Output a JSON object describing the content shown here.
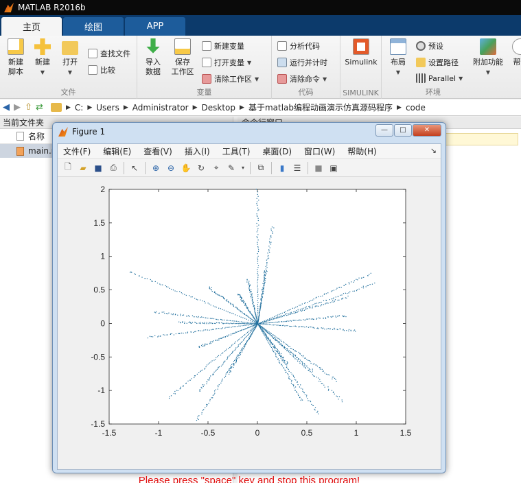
{
  "app": {
    "title": "MATLAB R2016b"
  },
  "tabs": [
    {
      "label": "主页"
    },
    {
      "label": "绘图"
    },
    {
      "label": "APP"
    }
  ],
  "ribbon": {
    "file": {
      "group_label": "文件",
      "new_script": "新建\n脚本",
      "new": "新建",
      "open": "打开",
      "find_files": "查找文件",
      "compare": "比较"
    },
    "variable": {
      "group_label": "变量",
      "import": "导入\n数据",
      "save_ws": "保存\n工作区",
      "new_var": "新建变量",
      "open_var": "打开变量",
      "clear_ws": "清除工作区"
    },
    "code": {
      "group_label": "代码",
      "analyze": "分析代码",
      "run_time": "运行并计时",
      "clear_cmd": "清除命令"
    },
    "simulink": {
      "group_label": "SIMULINK",
      "label": "Simulink"
    },
    "env": {
      "group_label": "环境",
      "layout": "布局",
      "prefs": "预设",
      "set_path": "设置路径",
      "parallel": "Parallel",
      "addons": "附加功能",
      "help_partial": "帮"
    }
  },
  "address": {
    "crumbs": [
      "C:",
      "Users",
      "Administrator",
      "Desktop",
      "基于matlab编程动画演示仿真源码程序",
      "code"
    ]
  },
  "left_panel": {
    "title": "当前文件夹",
    "col_name": "名称",
    "file": "main.r"
  },
  "right_panel": {
    "title": "命令行窗口"
  },
  "figure": {
    "title": "Figure 1",
    "menu": [
      "文件(F)",
      "编辑(E)",
      "查看(V)",
      "插入(I)",
      "工具(T)",
      "桌面(D)",
      "窗口(W)",
      "帮助(H)"
    ],
    "message": "Please press \"space\" key and stop this program!"
  },
  "chart_data": {
    "type": "scatter",
    "xlim": [
      -1.5,
      1.5
    ],
    "ylim": [
      -1.5,
      2
    ],
    "xticks": [
      "-1.5",
      "-1",
      "-0.5",
      "0",
      "0.5",
      "1",
      "1.5"
    ],
    "yticks": [
      "-1.5",
      "-1",
      "-0.5",
      "0",
      "0.5",
      "1",
      "1.5",
      "2"
    ],
    "marker_color": "#1f6e9c",
    "grid": false,
    "rays": [
      [
        0.0,
        2.0
      ],
      [
        0.15,
        1.45
      ],
      [
        -1.3,
        0.78
      ],
      [
        -0.5,
        0.55
      ],
      [
        -0.2,
        0.45
      ],
      [
        -0.1,
        0.65
      ],
      [
        0.08,
        0.8
      ],
      [
        1.15,
        0.75
      ],
      [
        1.18,
        0.6
      ],
      [
        0.9,
        0.4
      ],
      [
        0.9,
        0.12
      ],
      [
        1.0,
        -0.1
      ],
      [
        -1.05,
        0.18
      ],
      [
        -0.8,
        0.02
      ],
      [
        -1.1,
        -0.2
      ],
      [
        -0.6,
        -0.35
      ],
      [
        -0.9,
        -1.1
      ],
      [
        -0.6,
        -1.0
      ],
      [
        -0.62,
        -1.45
      ],
      [
        -0.3,
        -0.75
      ],
      [
        0.45,
        -1.15
      ],
      [
        0.62,
        -1.35
      ],
      [
        0.8,
        -0.85
      ],
      [
        0.85,
        -1.15
      ],
      [
        0.3,
        -0.6
      ],
      [
        0.55,
        -0.7
      ]
    ]
  }
}
